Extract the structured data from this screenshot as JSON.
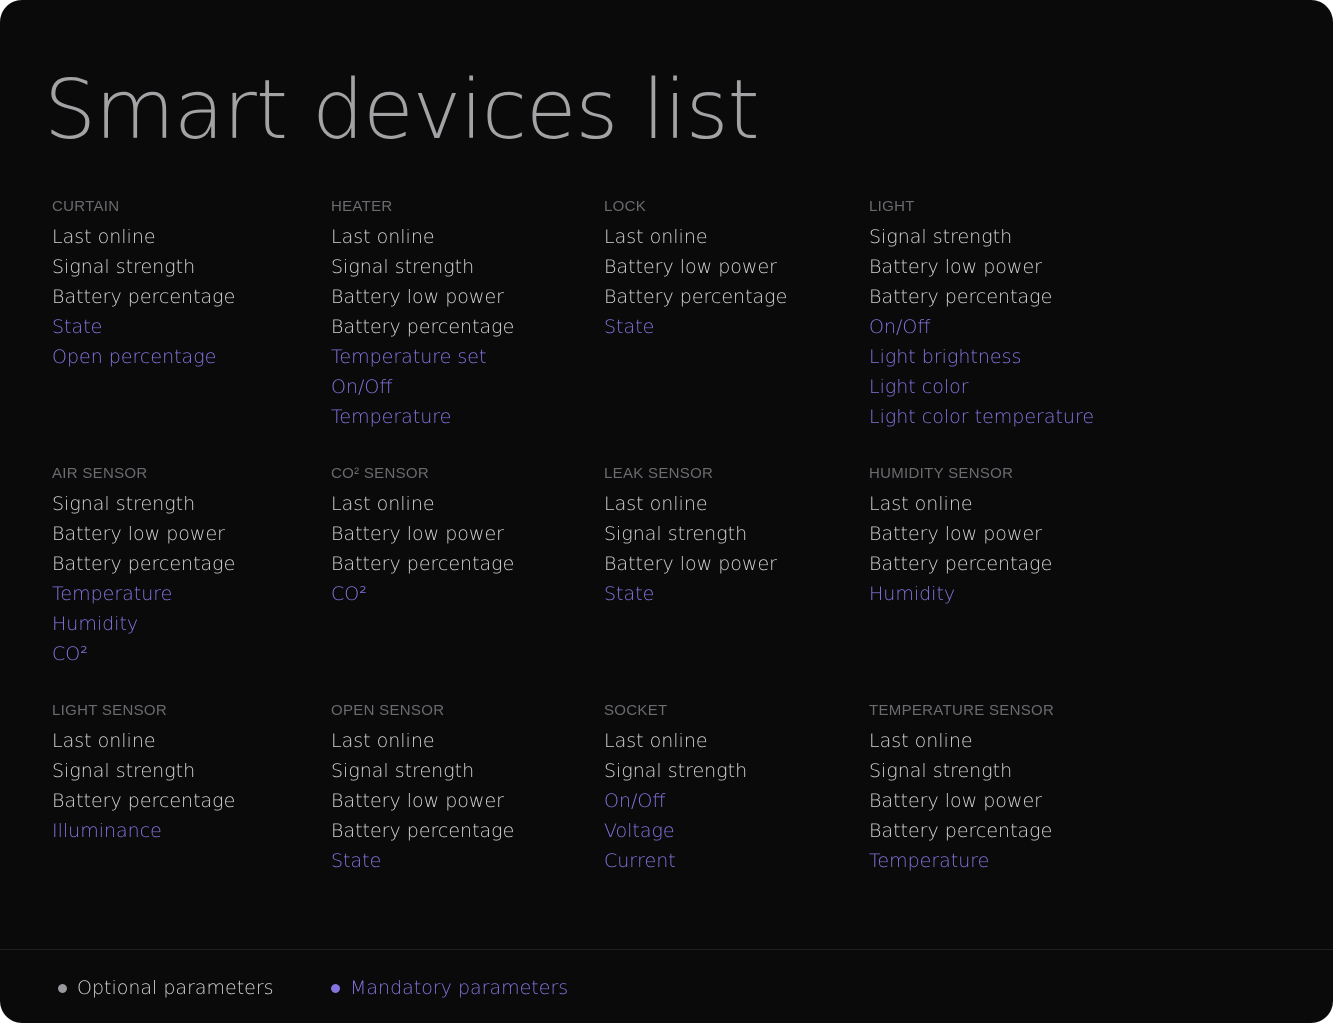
{
  "title": "Smart devices list",
  "colors": {
    "background": "#0a0a0b",
    "optional": "#d4d4d6",
    "mandatory": "#8674e0",
    "group_title": "#6b6b70",
    "title": "#a3a3a6"
  },
  "groups": [
    {
      "title": "CURTAIN",
      "params": [
        {
          "label": "Last online",
          "mandatory": false
        },
        {
          "label": "Signal strength",
          "mandatory": false
        },
        {
          "label": "Battery percentage",
          "mandatory": false
        },
        {
          "label": "State",
          "mandatory": true
        },
        {
          "label": "Open percentage",
          "mandatory": true
        }
      ]
    },
    {
      "title": "HEATER",
      "params": [
        {
          "label": "Last online",
          "mandatory": false
        },
        {
          "label": "Signal strength",
          "mandatory": false
        },
        {
          "label": "Battery low power",
          "mandatory": false
        },
        {
          "label": "Battery percentage",
          "mandatory": false
        },
        {
          "label": "Temperature set",
          "mandatory": true
        },
        {
          "label": "On/Off",
          "mandatory": true
        },
        {
          "label": "Temperature",
          "mandatory": true
        }
      ]
    },
    {
      "title": "LOCK",
      "params": [
        {
          "label": "Last online",
          "mandatory": false
        },
        {
          "label": "Battery low power",
          "mandatory": false
        },
        {
          "label": "Battery percentage",
          "mandatory": false
        },
        {
          "label": "State",
          "mandatory": true
        }
      ]
    },
    {
      "title": "LIGHT",
      "params": [
        {
          "label": "Signal strength",
          "mandatory": false
        },
        {
          "label": "Battery low power",
          "mandatory": false
        },
        {
          "label": "Battery percentage",
          "mandatory": false
        },
        {
          "label": "On/Off",
          "mandatory": true
        },
        {
          "label": "Light brightness",
          "mandatory": true
        },
        {
          "label": "Light color",
          "mandatory": true
        },
        {
          "label": "Light color temperature",
          "mandatory": true
        }
      ]
    },
    {
      "title": "AIR SENSOR",
      "params": [
        {
          "label": "Signal strength",
          "mandatory": false
        },
        {
          "label": "Battery low power",
          "mandatory": false
        },
        {
          "label": "Battery percentage",
          "mandatory": false
        },
        {
          "label": "Temperature",
          "mandatory": true
        },
        {
          "label": "Humidity",
          "mandatory": true
        },
        {
          "label": "CO²",
          "mandatory": true
        }
      ]
    },
    {
      "title": "CO² SENSOR",
      "params": [
        {
          "label": "Last online",
          "mandatory": false
        },
        {
          "label": "Battery low power",
          "mandatory": false
        },
        {
          "label": "Battery percentage",
          "mandatory": false
        },
        {
          "label": "CO²",
          "mandatory": true
        }
      ]
    },
    {
      "title": "LEAK SENSOR",
      "params": [
        {
          "label": "Last online",
          "mandatory": false
        },
        {
          "label": "Signal strength",
          "mandatory": false
        },
        {
          "label": "Battery low power",
          "mandatory": false
        },
        {
          "label": "State",
          "mandatory": true
        }
      ]
    },
    {
      "title": "HUMIDITY SENSOR",
      "params": [
        {
          "label": "Last online",
          "mandatory": false
        },
        {
          "label": "Battery low power",
          "mandatory": false
        },
        {
          "label": "Battery percentage",
          "mandatory": false
        },
        {
          "label": "Humidity",
          "mandatory": true
        }
      ]
    },
    {
      "title": "LIGHT SENSOR",
      "params": [
        {
          "label": "Last online",
          "mandatory": false
        },
        {
          "label": "Signal strength",
          "mandatory": false
        },
        {
          "label": "Battery percentage",
          "mandatory": false
        },
        {
          "label": "Illuminance",
          "mandatory": true
        }
      ]
    },
    {
      "title": "OPEN SENSOR",
      "params": [
        {
          "label": "Last online",
          "mandatory": false
        },
        {
          "label": "Signal strength",
          "mandatory": false
        },
        {
          "label": "Battery low power",
          "mandatory": false
        },
        {
          "label": "Battery percentage",
          "mandatory": false
        },
        {
          "label": "State",
          "mandatory": true
        }
      ]
    },
    {
      "title": "SOCKET",
      "params": [
        {
          "label": "Last online",
          "mandatory": false
        },
        {
          "label": "Signal strength",
          "mandatory": false
        },
        {
          "label": "On/Off",
          "mandatory": true
        },
        {
          "label": "Voltage",
          "mandatory": true
        },
        {
          "label": "Current",
          "mandatory": true
        }
      ]
    },
    {
      "title": "TEMPERATURE SENSOR",
      "params": [
        {
          "label": "Last online",
          "mandatory": false
        },
        {
          "label": "Signal strength",
          "mandatory": false
        },
        {
          "label": "Battery low power",
          "mandatory": false
        },
        {
          "label": "Battery percentage",
          "mandatory": false
        },
        {
          "label": "Temperature",
          "mandatory": true
        }
      ]
    }
  ],
  "legend": {
    "optional_label": "Optional parameters",
    "mandatory_label": "Mandatory parameters"
  }
}
